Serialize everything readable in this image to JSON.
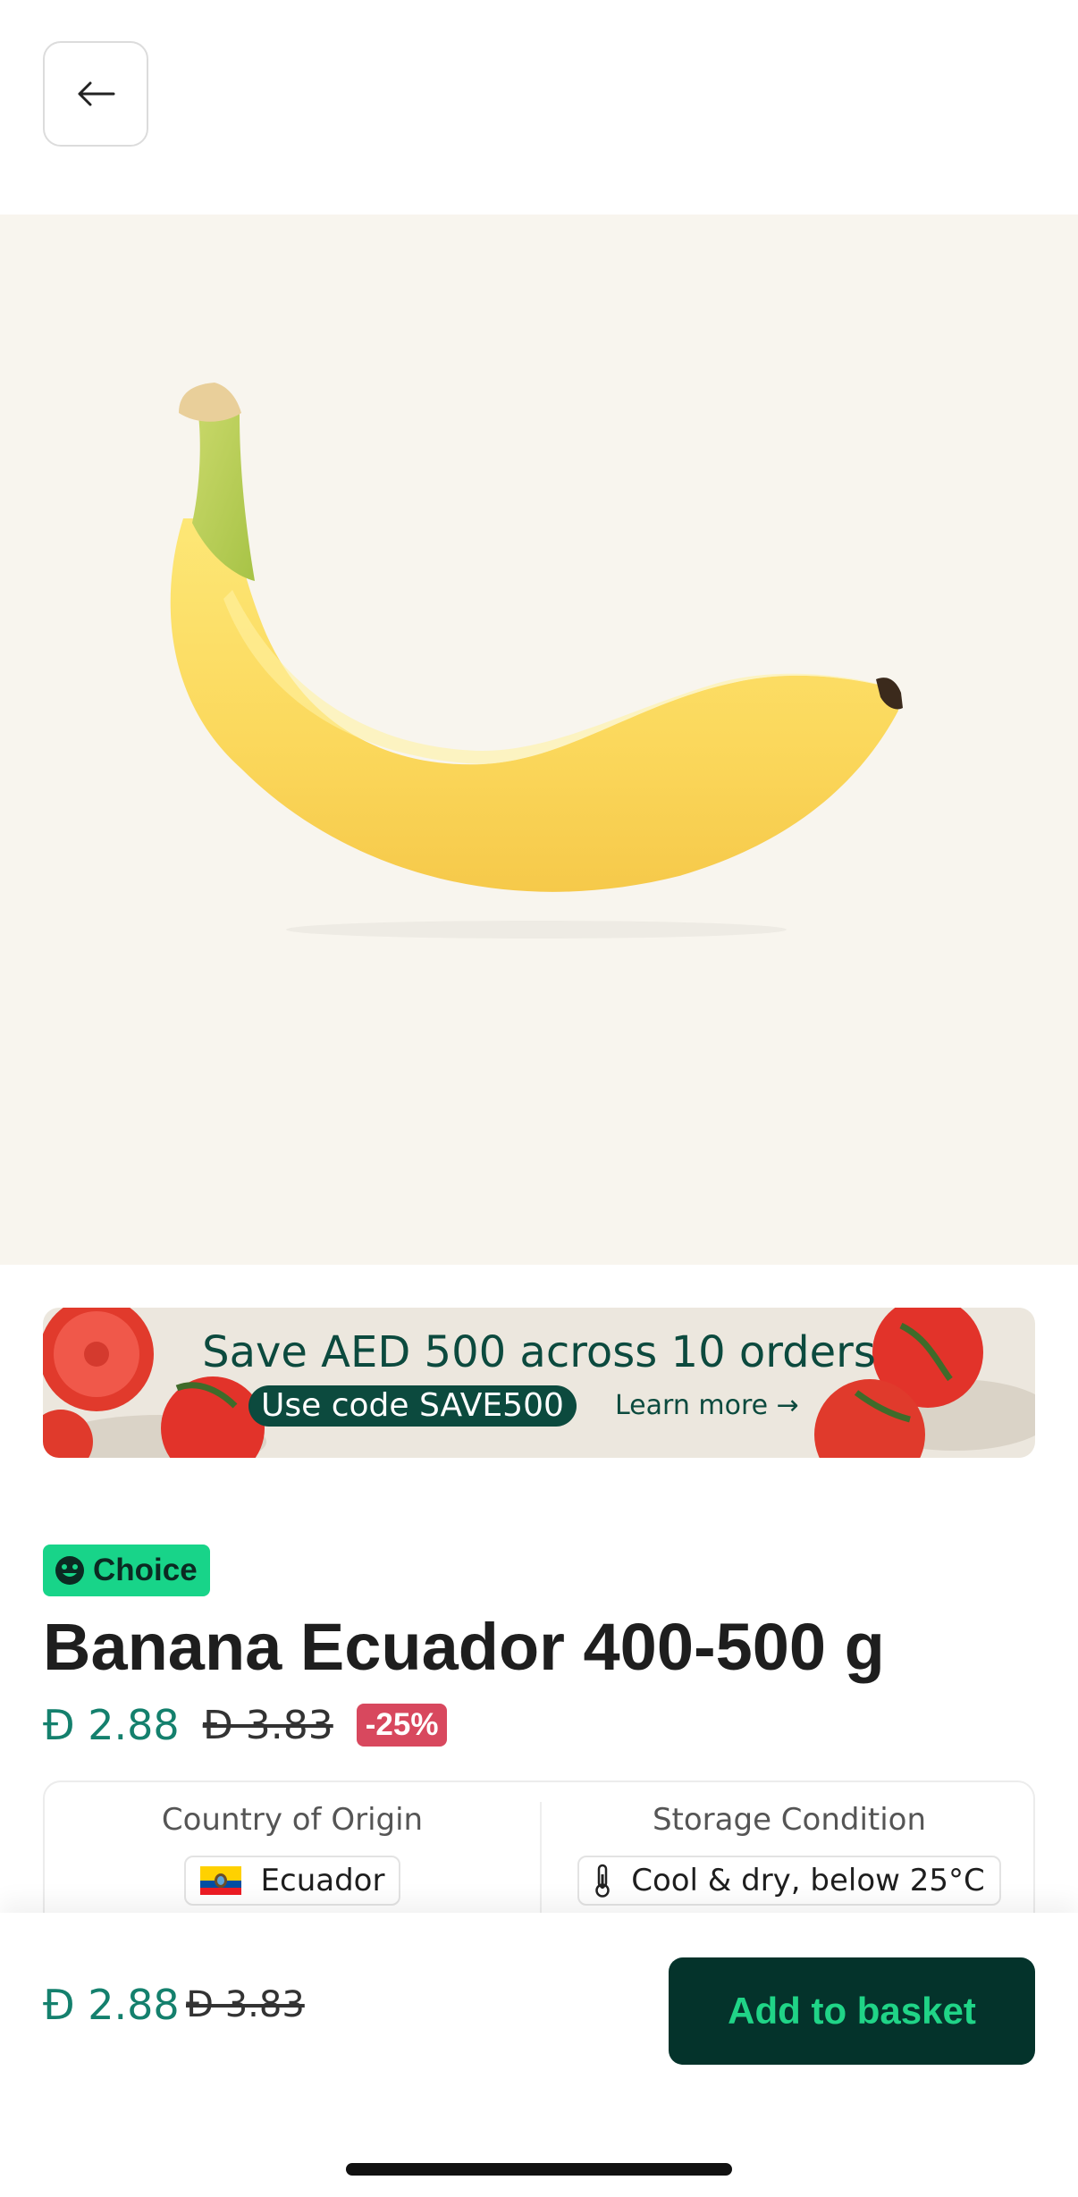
{
  "header": {
    "back_icon": "arrow-left-icon"
  },
  "gallery": {
    "image": "banana-photo",
    "page_count": 2,
    "active_index": 1
  },
  "promo": {
    "title": "Save AED 500 across 10 orders",
    "code_label": "Use code SAVE500",
    "learn_more": "Learn more →"
  },
  "product": {
    "badge": "Choice",
    "badge_icon": "smiley-face-icon",
    "title": "Banana Ecuador 400-500 g",
    "price": "Đ 2.88",
    "old_price": "Đ 3.83",
    "discount": "-25%"
  },
  "info": {
    "origin_label": "Country of Origin",
    "origin_value": "Ecuador",
    "origin_icon": "ecuador-flag-icon",
    "storage_label": "Storage Condition",
    "storage_value": "Cool & dry, below 25°C",
    "storage_icon": "thermometer-icon"
  },
  "footer": {
    "price": "Đ 2.88",
    "old_price": "Đ 3.83",
    "add_label": "Add to basket"
  },
  "colors": {
    "accent": "#14806d",
    "button_bg": "#04332b",
    "button_text": "#20d487",
    "badge": "#18d489",
    "discount": "#d8485e"
  }
}
